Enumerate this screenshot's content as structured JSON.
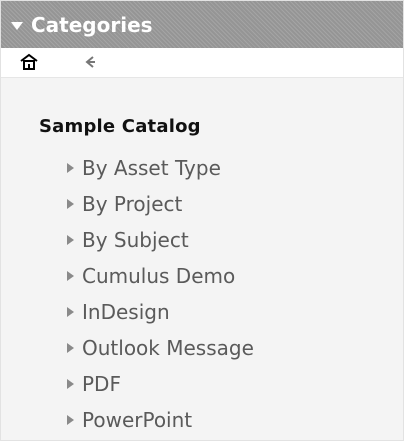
{
  "panel": {
    "title": "Categories"
  },
  "toolbar": {
    "home_icon": "home-icon",
    "back_icon": "back-arrow-icon"
  },
  "tree": {
    "root_label": "Sample Catalog",
    "items": [
      {
        "label": "By Asset Type"
      },
      {
        "label": "By Project"
      },
      {
        "label": "By Subject"
      },
      {
        "label": "Cumulus Demo"
      },
      {
        "label": "InDesign"
      },
      {
        "label": "Outlook Message"
      },
      {
        "label": "PDF"
      },
      {
        "label": "PowerPoint"
      }
    ]
  },
  "colors": {
    "header_bg": "#9a9a9a",
    "panel_bg": "#f4f4f4",
    "text": "#5a5a5a",
    "title": "#111111"
  }
}
